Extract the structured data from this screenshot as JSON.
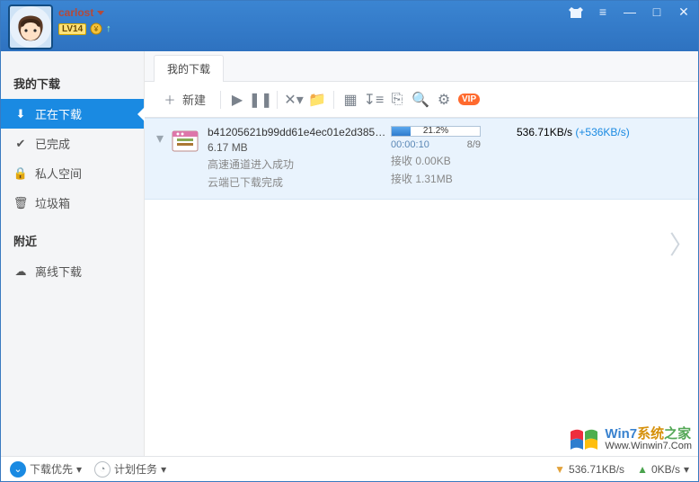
{
  "user": {
    "name": "carlost",
    "level": "LV14"
  },
  "window": {
    "tab_title": "我的下载",
    "toolbar": {
      "new": "新建"
    }
  },
  "sidebar": {
    "section_downloads": "我的下载",
    "items": [
      {
        "label": "正在下载"
      },
      {
        "label": "已完成"
      },
      {
        "label": "私人空间"
      },
      {
        "label": "垃圾箱"
      }
    ],
    "section_nearby": "附近",
    "item_offline": "离线下载"
  },
  "task": {
    "filename": "b41205621b99dd61e4ec01e2d3857…",
    "size": "6.17 MB",
    "line1": "高速通道进入成功",
    "line2": "云端已下载完成",
    "progress_pct": "21.2%",
    "progress_fill": 21.2,
    "elapsed": "00:00:10",
    "sources": "8/9",
    "recv1_label": "接收",
    "recv1_value": "0.00KB",
    "recv2_label": "接收",
    "recv2_value": "1.31MB",
    "speed": "536.71KB/s",
    "speed_bonus": "(+536KB/s)"
  },
  "statusbar": {
    "priority": "下载优先",
    "schedule": "计划任务",
    "down_speed": "536.71KB/s",
    "up_speed": "0KB/s"
  },
  "watermark": {
    "line1_a": "Win7",
    "line1_b": "系统",
    "line1_c": "之家",
    "line2": "Www.Winwin7.Com"
  }
}
